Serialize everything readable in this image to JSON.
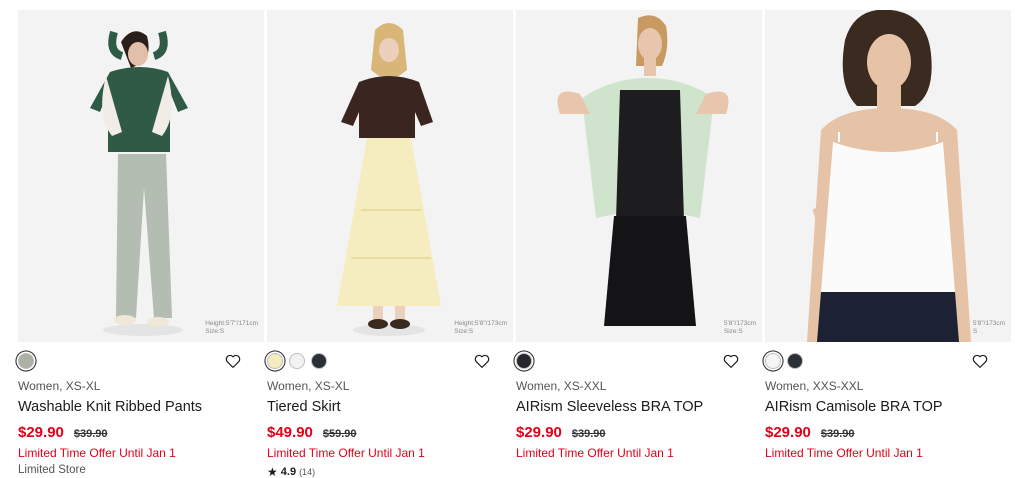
{
  "products": [
    {
      "meta": "Women, XS-XL",
      "name": "Washable Knit Ribbed Pants",
      "price": "$29.90",
      "old_price": "$39.90",
      "offer": "Limited Time Offer Until Jan 1",
      "extra": "Limited Store",
      "model_height": "Height:5'7\"/171cm",
      "model_size": "Size:S",
      "swatches": [
        "#a9b2a4"
      ],
      "heart_icon": "heart-outline-icon"
    },
    {
      "meta": "Women, XS-XL",
      "name": "Tiered Skirt",
      "price": "$49.90",
      "old_price": "$59.90",
      "offer": "Limited Time Offer Until Jan 1",
      "rating": {
        "score": "4.9",
        "count": "(14)"
      },
      "model_height": "Height:5'8\"/173cm",
      "model_size": "Size:S",
      "swatches": [
        "#f3ecbe",
        "#f2f2f2",
        "#2b2f38"
      ],
      "heart_icon": "heart-outline-icon"
    },
    {
      "meta": "Women, XS-XXL",
      "name": "AIRism Sleeveless BRA TOP",
      "price": "$29.90",
      "old_price": "$39.90",
      "offer": "Limited Time Offer Until Jan 1",
      "model_height": "5'8\"/173cm",
      "model_size": "Size:S",
      "swatches": [
        "#25272d"
      ],
      "heart_icon": "heart-outline-icon"
    },
    {
      "meta": "Women, XXS-XXL",
      "name": "AIRism Camisole BRA TOP",
      "price": "$29.90",
      "old_price": "$39.90",
      "offer": "Limited Time Offer Until Jan 1",
      "model_height": "5'8\"/173cm",
      "model_size": "S",
      "swatches": [
        "#f5f5f5",
        "#2b2f38"
      ],
      "heart_icon": "heart-outline-icon"
    }
  ],
  "colors": {
    "sale_red": "#e2001a",
    "text": "#1b1b1b",
    "muted": "#555555"
  }
}
